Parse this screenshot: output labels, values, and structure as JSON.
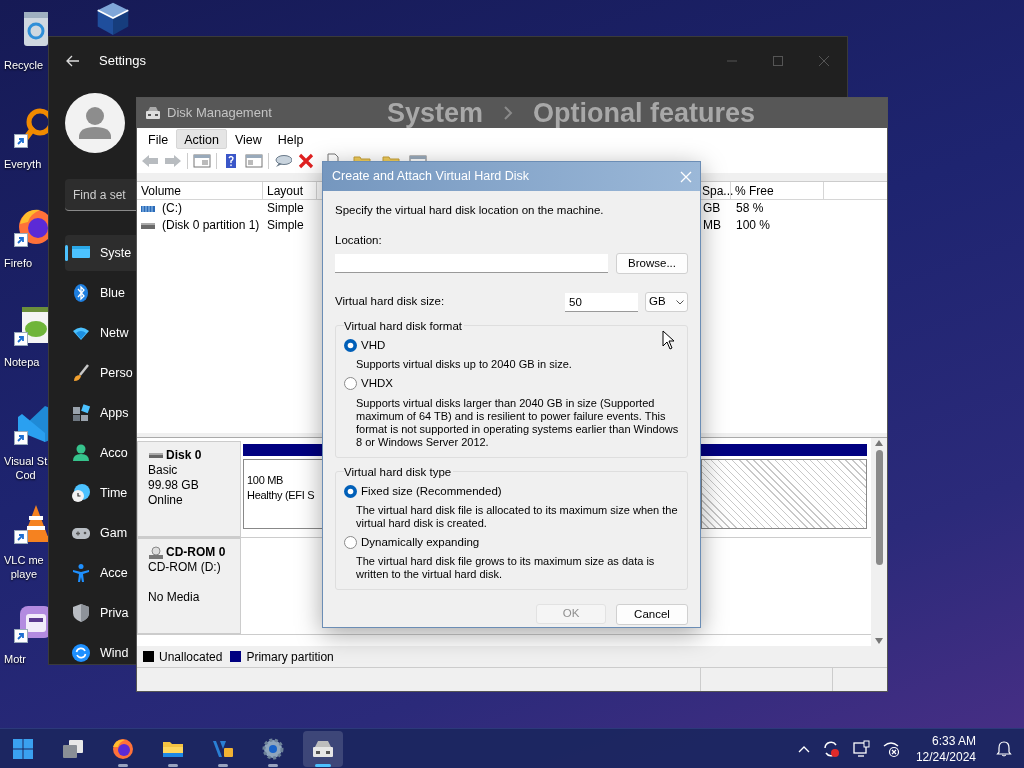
{
  "desktop": {
    "icons": [
      {
        "kind": "recycle",
        "label": [
          "Recycle"
        ],
        "shortcut": false
      },
      {
        "kind": "everything",
        "label": [
          "Everyth"
        ],
        "shortcut": true
      },
      {
        "kind": "firefox",
        "label": [
          "Firefo"
        ],
        "shortcut": true
      },
      {
        "kind": "notepad",
        "label": [
          "Notepa"
        ],
        "shortcut": true
      },
      {
        "kind": "vscode",
        "label": [
          "Visual St",
          "Cod"
        ],
        "shortcut": true
      },
      {
        "kind": "vlc",
        "label": [
          "VLC me",
          "playe"
        ],
        "shortcut": true
      },
      {
        "kind": "motr",
        "label": [
          "Motr"
        ],
        "shortcut": true
      }
    ],
    "second_column": [
      {
        "kind": "vbox"
      }
    ]
  },
  "settings": {
    "title": "Settings",
    "breadcrumb": [
      "System",
      "Optional features"
    ],
    "search": {
      "placeholder": "Find a set"
    },
    "nav": [
      {
        "kind": "system",
        "label": "Syste",
        "selected": true
      },
      {
        "kind": "bluetooth",
        "label": "Blue",
        "selected": false
      },
      {
        "kind": "network",
        "label": "Netw",
        "selected": false
      },
      {
        "kind": "personalization",
        "label": "Perso",
        "selected": false
      },
      {
        "kind": "apps",
        "label": "Apps",
        "selected": false
      },
      {
        "kind": "accounts",
        "label": "Acco",
        "selected": false
      },
      {
        "kind": "time",
        "label": "Time",
        "selected": false
      },
      {
        "kind": "gaming",
        "label": "Gam",
        "selected": false
      },
      {
        "kind": "accessibility",
        "label": "Acce",
        "selected": false
      },
      {
        "kind": "privacy",
        "label": "Priva",
        "selected": false
      },
      {
        "kind": "update",
        "label": "Wind",
        "selected": false
      }
    ]
  },
  "disk_management": {
    "title": "Disk Management",
    "menu": [
      {
        "label": "File",
        "selected": false
      },
      {
        "label": "Action",
        "selected": true
      },
      {
        "label": "View",
        "selected": false
      },
      {
        "label": "Help",
        "selected": false
      }
    ],
    "table": {
      "columns": [
        "Volume",
        "Layout",
        "Spa...",
        "% Free"
      ],
      "rows": [
        {
          "kind": "volume",
          "cells": [
            "(C:)",
            "Simple",
            "GB",
            "58 %"
          ]
        },
        {
          "kind": "partition",
          "cells": [
            "(Disk 0 partition 1)",
            "Simple",
            "MB",
            "100 %"
          ]
        }
      ]
    },
    "disks": [
      {
        "kind": "disk",
        "name": "Disk 0",
        "type": "Basic",
        "size": "99.98 GB",
        "status": "Online",
        "partitions": [
          {
            "size": "100 MB",
            "status": "Healthy (EFI S",
            "selected": false
          },
          {
            "selected": true
          }
        ]
      },
      {
        "kind": "cdrom",
        "name": "CD-ROM 0",
        "type": "CD-ROM (D:)",
        "status": "No Media"
      }
    ],
    "legend": [
      {
        "label": "Unallocated",
        "color": "#000000"
      },
      {
        "label": "Primary partition",
        "color": "#000080"
      }
    ]
  },
  "dialog": {
    "title": "Create and Attach Virtual Hard Disk",
    "intro": "Specify the virtual hard disk location on the machine.",
    "location": {
      "label": "Location:"
    },
    "browse": "Browse...",
    "size": {
      "label": "Virtual hard disk size:",
      "value": "50",
      "unit": "GB"
    },
    "groups": [
      {
        "title": "Virtual hard disk format",
        "options": [
          {
            "label": "VHD",
            "description": "Supports virtual disks up to 2040 GB in size.",
            "selected": true
          },
          {
            "label": "VHDX",
            "description": "Supports virtual disks larger than 2040 GB in size (Supported maximum of 64 TB) and is resilient to power failure events. This format is not supported in operating systems earlier than Windows 8 or Windows Server 2012.",
            "selected": false
          }
        ]
      },
      {
        "title": "Virtual hard disk type",
        "options": [
          {
            "label": "Fixed size (Recommended)",
            "description": "The virtual hard disk file is allocated to its maximum size when the virtual hard disk is created.",
            "selected": true
          },
          {
            "label": "Dynamically expanding",
            "description": "The virtual hard disk file grows to its maximum size as data is written to the virtual hard disk.",
            "selected": false
          }
        ]
      }
    ],
    "buttons": [
      {
        "label": "OK",
        "disabled": true
      },
      {
        "label": "Cancel",
        "disabled": false
      }
    ]
  },
  "taskbar": {
    "apps": [
      {
        "kind": "start",
        "running": false,
        "selected": false
      },
      {
        "kind": "taskview",
        "running": false,
        "selected": false
      },
      {
        "kind": "firefox",
        "running": true,
        "selected": false
      },
      {
        "kind": "explorer",
        "running": true,
        "selected": false
      },
      {
        "kind": "devapp",
        "running": true,
        "selected": false
      },
      {
        "kind": "settings",
        "running": true,
        "selected": false
      },
      {
        "kind": "diskmgmt",
        "running": true,
        "selected": true
      }
    ],
    "time": "6:33 AM",
    "date": "12/24/2024"
  }
}
